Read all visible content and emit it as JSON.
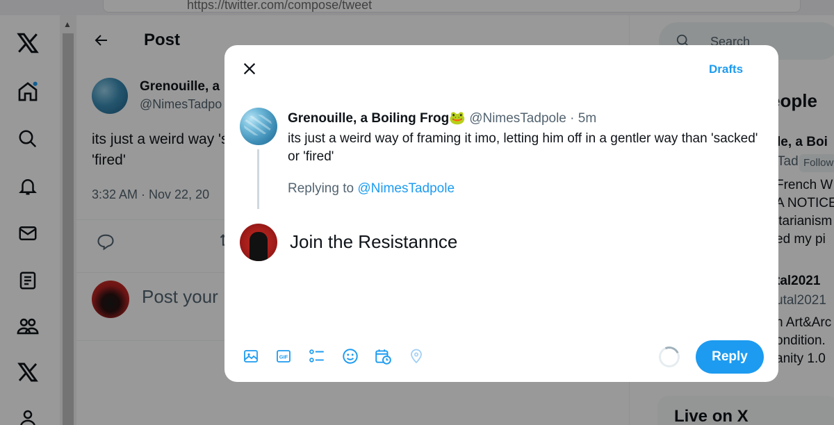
{
  "browser": {
    "url": "https://twitter.com/compose/tweet"
  },
  "nav": {
    "items": [
      {
        "icon": "x-logo-icon"
      },
      {
        "icon": "home-icon",
        "has_notification_dot": true
      },
      {
        "icon": "search-icon"
      },
      {
        "icon": "bell-icon"
      },
      {
        "icon": "mail-icon"
      },
      {
        "icon": "lists-icon"
      },
      {
        "icon": "communities-icon"
      },
      {
        "icon": "x-premium-icon"
      },
      {
        "icon": "profile-icon"
      }
    ]
  },
  "main": {
    "header_title": "Post",
    "post": {
      "name": "Grenouille, a",
      "handle": "@NimesTadpo",
      "text": "its just a weird way 'sacked' or 'fired'",
      "timestamp": "3:32 AM · Nov 22, 20"
    },
    "reply_placeholder": "Post your"
  },
  "right": {
    "search_placeholder": "Search",
    "heading": "eople",
    "people_1_name": "le, a Boi",
    "people_1_handle": "Tad",
    "follow_label": "Follow",
    "bio_line_1": "French W",
    "bio_line_2": "A NOTICE",
    "bio_line_3": "itarianism",
    "bio_line_4": "ed my pi",
    "people_2_name": "tal2021",
    "people_2_handle": "utal2021",
    "bio2_line_1": "n Art&Arc",
    "bio2_line_2": "ondition.",
    "bio2_line_3": "anity 1.0",
    "live_heading": "Live on X"
  },
  "modal": {
    "drafts_label": "Drafts",
    "tweet": {
      "name": "Grenouille, a Boiling Frog",
      "emoji": "🐸",
      "handle": "@NimesTadpole",
      "separator": " · ",
      "time": "5m",
      "text": "its just a weird way of framing it imo, letting him off in a gentler way than 'sacked' or 'fired'"
    },
    "replying_prefix": "Replying to ",
    "replying_to": "@NimesTadpole",
    "compose_text": "Join the Resistannce",
    "toolbar_icons": [
      "image-icon",
      "gif-icon",
      "poll-icon",
      "emoji-icon",
      "schedule-icon",
      "location-icon"
    ],
    "reply_button": "Reply",
    "accent": "#1d9bf0"
  }
}
